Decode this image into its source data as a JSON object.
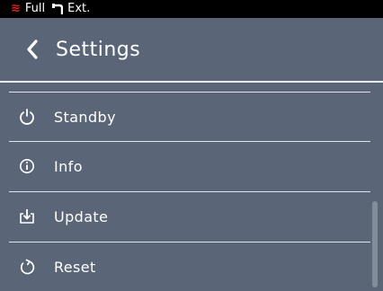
{
  "status_bar": {
    "heat_symbol": "≋",
    "mode": "Full",
    "source": "Ext.",
    "heat_color": "#e2231a"
  },
  "header": {
    "title": "Settings",
    "back_icon": "chevron-left-icon"
  },
  "menu": {
    "items": [
      {
        "label": "Standby",
        "icon": "power-icon"
      },
      {
        "label": "Info",
        "icon": "info-icon"
      },
      {
        "label": "Update",
        "icon": "download-icon"
      },
      {
        "label": "Reset",
        "icon": "reset-icon"
      }
    ]
  },
  "colors": {
    "background": "#5a6677",
    "statusbar": "#000000",
    "text": "#ffffff",
    "divider": "#dfe3e8"
  }
}
